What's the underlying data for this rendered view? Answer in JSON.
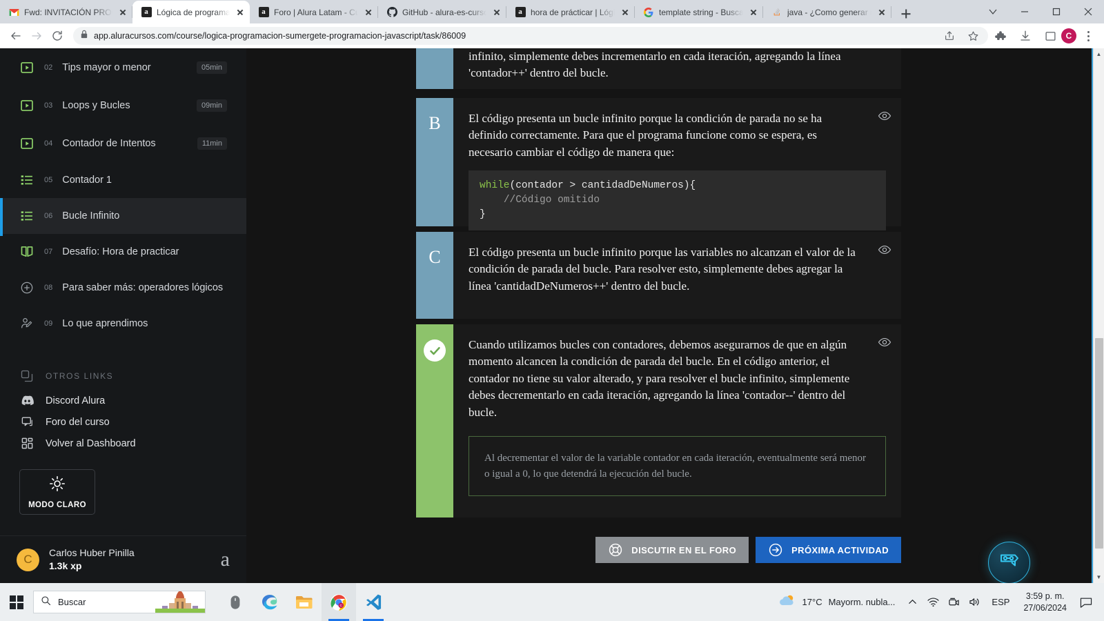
{
  "browser": {
    "tabs": [
      {
        "title": "Fwd: INVITACIÓN PROC",
        "favicon": "gmail-icon",
        "active": false
      },
      {
        "title": "Lógica de programación",
        "favicon": "alura-icon",
        "active": true
      },
      {
        "title": "Foro | Alura Latam - Cur",
        "favicon": "alura-icon",
        "active": false
      },
      {
        "title": "GitHub - alura-es-curso",
        "favicon": "github-icon",
        "active": false
      },
      {
        "title": "hora de prácticar | Lógi",
        "favicon": "alura-icon",
        "active": false
      },
      {
        "title": "template string - Busca",
        "favicon": "google-icon",
        "active": false
      },
      {
        "title": "java - ¿Como generar n",
        "favicon": "stackoverflow-icon",
        "active": false
      }
    ],
    "new_tab_label": "+",
    "url": "app.aluracursos.com/course/logica-programacion-sumergete-programacion-javascript/task/86009",
    "profile_initial": "C",
    "toolbar_icons": [
      "share-icon",
      "bookmark-star-icon",
      "extensions-puzzle-icon",
      "downloads-icon",
      "sidepanel-icon"
    ]
  },
  "sidebar": {
    "lessons": [
      {
        "num": "02",
        "label": "Tips mayor o menor",
        "duration": "05min",
        "icon": "video-icon",
        "active": false
      },
      {
        "num": "03",
        "label": "Loops y Bucles",
        "duration": "09min",
        "icon": "video-icon",
        "active": false
      },
      {
        "num": "04",
        "label": "Contador de Intentos",
        "duration": "11min",
        "icon": "video-icon",
        "active": false
      },
      {
        "num": "05",
        "label": "Contador 1",
        "duration": "",
        "icon": "list-icon",
        "active": false
      },
      {
        "num": "06",
        "label": "Bucle Infinito",
        "duration": "",
        "icon": "list-icon",
        "active": true
      },
      {
        "num": "07",
        "label": "Desafío: Hora de practicar",
        "duration": "",
        "icon": "book-icon",
        "active": false
      },
      {
        "num": "08",
        "label": "Para saber más: operadores lógicos",
        "duration": "",
        "icon": "plus-circle-icon",
        "active": false
      },
      {
        "num": "09",
        "label": "Lo que aprendimos",
        "duration": "",
        "icon": "user-edit-icon",
        "active": false
      }
    ],
    "links_header": "OTROS LINKS",
    "links": [
      {
        "label": "Discord Alura",
        "icon": "discord-icon"
      },
      {
        "label": "Foro del curso",
        "icon": "chat-icon"
      },
      {
        "label": "Volver al Dashboard",
        "icon": "dashboard-icon"
      }
    ],
    "theme_toggle": {
      "label": "MODO CLARO",
      "icon": "sun-icon"
    },
    "user": {
      "initial": "C",
      "name": "Carlos Huber Pinilla",
      "xp": "1.3k xp",
      "brand_mark": "a"
    }
  },
  "quiz": {
    "options": [
      {
        "letter": "",
        "partial": true,
        "text": "infinito, simplemente debes incrementarlo en cada iteración, agregando la línea 'contador++' dentro del bucle.",
        "correct": false,
        "eye_icon": "eye-icon"
      },
      {
        "letter": "B",
        "partial": false,
        "text": "El código presenta un bucle infinito porque la condición de parada no se ha definido correctamente. Para que el programa funcione como se espera, es necesario cambiar el código de manera que:",
        "code": {
          "keyword": "while",
          "signature": "(contador > cantidadDeNumeros){",
          "comment": "//Código omitido",
          "close": "}"
        },
        "correct": false,
        "eye_icon": "eye-icon"
      },
      {
        "letter": "C",
        "partial": false,
        "text": "El código presenta un bucle infinito porque las variables no alcanzan el valor de la condición de parada del bucle. Para resolver esto, simplemente debes agregar la línea 'cantidadDeNumeros++' dentro del bucle.",
        "correct": false,
        "eye_icon": "eye-icon"
      },
      {
        "letter": "",
        "partial": false,
        "text": "Cuando utilizamos bucles con contadores, debemos asegurarnos de que en algún momento alcancen la condición de parada del bucle. En el código anterior, el contador no tiene su valor alterado, y para resolver el bucle infinito, simplemente debes decrementarlo en cada iteración, agregando la línea 'contador--' dentro del bucle.",
        "note": "Al decrementar el valor de la variable contador en cada iteración, eventualmente será menor o igual a 0, lo que detendrá la ejecución del bucle.",
        "correct": true,
        "check_icon": "check-circle-icon",
        "eye_icon": "eye-icon"
      }
    ],
    "actions": {
      "forum": {
        "label": "DISCUTIR EN EL FORO",
        "icon": "lifebuoy-icon"
      },
      "next": {
        "label": "PRÓXIMA ACTIVIDAD",
        "icon": "arrow-right-circle-icon"
      }
    },
    "chat_widget_icon": "chatbot-icon"
  },
  "taskbar": {
    "start_icon": "windows-start-icon",
    "search_placeholder": "Buscar",
    "apps": [
      {
        "name": "mouse-settings-icon",
        "open": false,
        "active": false
      },
      {
        "name": "microsoft-edge-icon",
        "open": false,
        "active": false
      },
      {
        "name": "file-explorer-icon",
        "open": false,
        "active": false
      },
      {
        "name": "google-chrome-icon",
        "open": true,
        "active": true
      },
      {
        "name": "vscode-icon",
        "open": true,
        "active": false
      }
    ],
    "weather": {
      "temp": "17°C",
      "desc": "Mayorm. nubla...",
      "icon": "partly-cloudy-icon"
    },
    "tray_icons": [
      "chevron-up-icon",
      "wifi-icon",
      "teams-camera-icon",
      "volume-icon"
    ],
    "language": "ESP",
    "time": "3:59 p. m.",
    "date": "27/06/2024",
    "action_center_icon": "notification-icon"
  },
  "colors": {
    "accent_blue": "#1d64c0",
    "option_bar": "#74a1b8",
    "correct_green": "#8dc36b",
    "sidebar_bg": "#16181a",
    "content_bg": "#141414",
    "lesson_icon_green": "#8fd46a",
    "active_marker": "#1e9ee8",
    "avatar_yellow": "#f5b93d"
  }
}
